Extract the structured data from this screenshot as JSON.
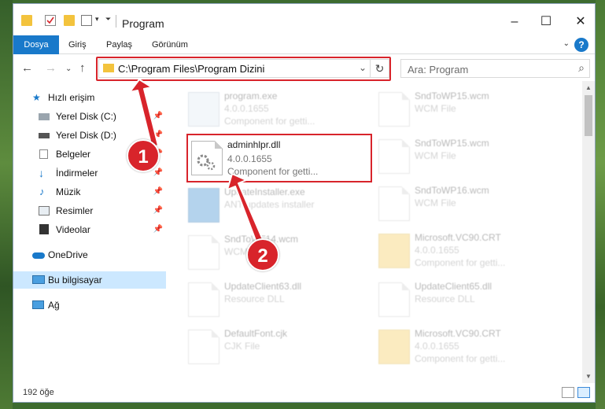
{
  "window": {
    "title": "Program"
  },
  "ribbon": {
    "tabs": [
      {
        "label": "Dosya",
        "active": true
      },
      {
        "label": "Giriş"
      },
      {
        "label": "Paylaş"
      },
      {
        "label": "Görünüm"
      }
    ]
  },
  "address": {
    "path": "C:\\Program Files\\Program Dizini"
  },
  "search": {
    "placeholder": "Ara: Program"
  },
  "sidebar": {
    "items": [
      {
        "label": "Hızlı erişim",
        "icon": "star-icon"
      },
      {
        "label": "Yerel Disk (C:)",
        "icon": "drive-icon"
      },
      {
        "label": "Yerel Disk (D:)",
        "icon": "drive-icon"
      },
      {
        "label": "Belgeler",
        "icon": "documents-icon"
      },
      {
        "label": "İndirmeler",
        "icon": "download-icon"
      },
      {
        "label": "Müzik",
        "icon": "music-icon"
      },
      {
        "label": "Resimler",
        "icon": "pictures-icon"
      },
      {
        "label": "Videolar",
        "icon": "video-icon"
      },
      {
        "label": "OneDrive",
        "icon": "cloud-icon"
      },
      {
        "label": "Bu bilgisayar",
        "icon": "computer-icon"
      },
      {
        "label": "Ağ",
        "icon": "network-icon"
      }
    ]
  },
  "files": {
    "highlighted": {
      "name": "adminhlpr.dll",
      "version": "4.0.0.1655",
      "description": "Component for getti..."
    },
    "left": [
      {
        "name": "program.exe",
        "line2": "4.0.0.1655",
        "line3": "Component for getti..."
      },
      {
        "name": "UpdateInstaller.exe",
        "line2": "ANT updates installer",
        "line3": ""
      },
      {
        "name": "SndToWF14.wcm",
        "line2": "WCM File",
        "line3": ""
      },
      {
        "name": "UpdateClient63.dll",
        "line2": "Resource DLL",
        "line3": ""
      },
      {
        "name": "DefaultFont.cjk",
        "line2": "CJK File",
        "line3": ""
      }
    ],
    "right": [
      {
        "name": "SndToWP15.wcm",
        "line2": "WCM File",
        "line3": ""
      },
      {
        "name": "SndToWP15.wcm",
        "line2": "WCM File",
        "line3": ""
      },
      {
        "name": "SndToWP16.wcm",
        "line2": "WCM File",
        "line3": ""
      },
      {
        "name": "Microsoft.VC90.CRT",
        "line2": "4.0.0.1655",
        "line3": "Component for getti..."
      },
      {
        "name": "UpdateClient65.dll",
        "line2": "Resource DLL",
        "line3": ""
      },
      {
        "name": "Microsoft.VC90.CRT",
        "line2": "4.0.0.1655",
        "line3": "Component for getti..."
      }
    ]
  },
  "markers": {
    "one": "1",
    "two": "2"
  },
  "status": {
    "count": "192 öğe"
  },
  "colors": {
    "accent": "#1979ca",
    "highlight": "#d8242b"
  }
}
